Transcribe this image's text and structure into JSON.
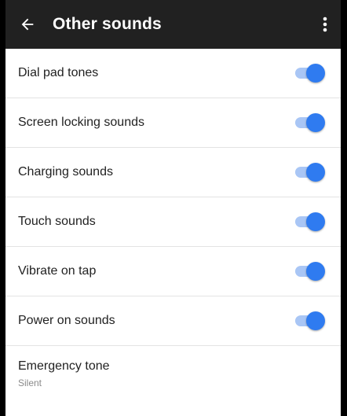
{
  "appbar": {
    "title": "Other sounds",
    "back_icon": "arrow-left-icon",
    "overflow_icon": "more-vert-icon",
    "background": "#212121"
  },
  "settings": {
    "items": [
      {
        "label": "Dial pad tones",
        "enabled": true
      },
      {
        "label": "Screen locking sounds",
        "enabled": true
      },
      {
        "label": "Charging sounds",
        "enabled": true
      },
      {
        "label": "Touch sounds",
        "enabled": true
      },
      {
        "label": "Vibrate on tap",
        "enabled": true
      },
      {
        "label": "Power on sounds",
        "enabled": true
      }
    ],
    "emergency": {
      "label": "Emergency tone",
      "value": "Silent"
    }
  },
  "colors": {
    "accent": "#2f7bf0",
    "track": "#a9c6f5"
  }
}
